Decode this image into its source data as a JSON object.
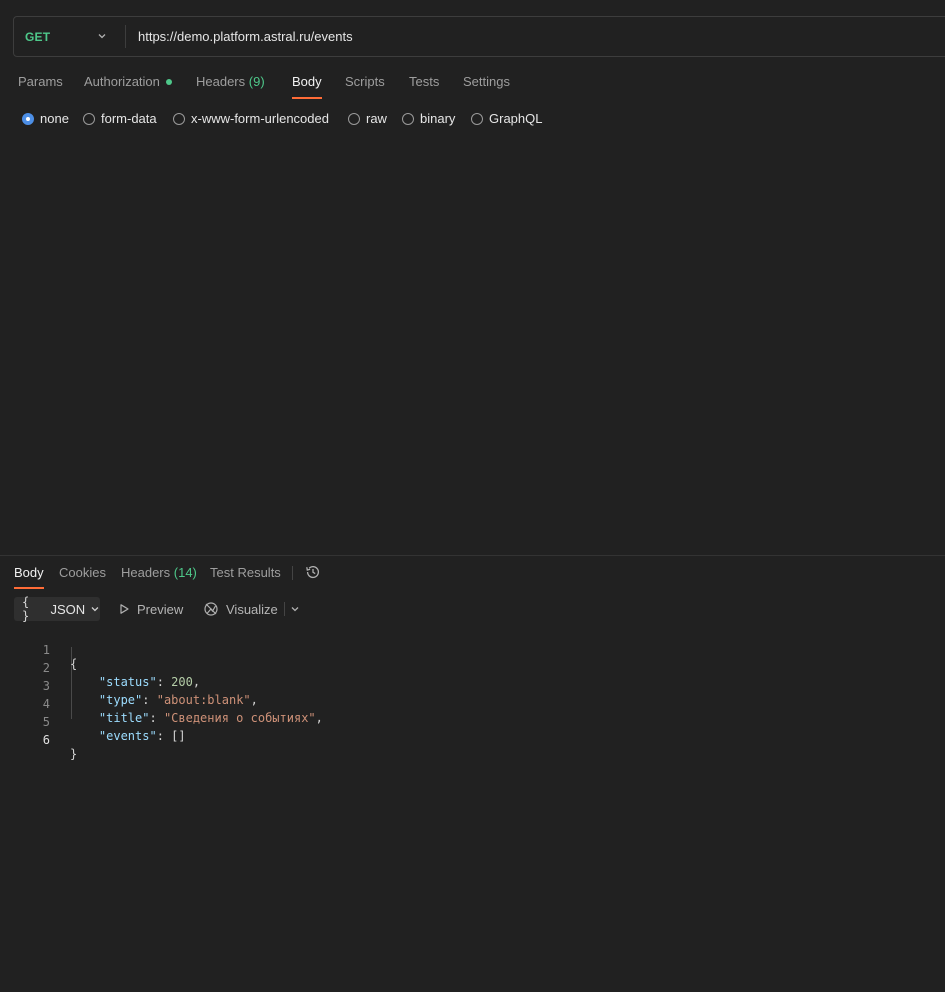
{
  "request": {
    "method": "GET",
    "url": "https://demo.platform.astral.ru/events"
  },
  "request_tabs": [
    {
      "label": "Params"
    },
    {
      "label": "Authorization"
    },
    {
      "label": "Headers",
      "count": "(9)"
    },
    {
      "label": "Body"
    },
    {
      "label": "Scripts"
    },
    {
      "label": "Tests"
    },
    {
      "label": "Settings"
    }
  ],
  "body_types": [
    {
      "label": "none",
      "checked": true
    },
    {
      "label": "form-data"
    },
    {
      "label": "x-www-form-urlencoded"
    },
    {
      "label": "raw"
    },
    {
      "label": "binary"
    },
    {
      "label": "GraphQL"
    }
  ],
  "response_tabs": [
    {
      "label": "Body"
    },
    {
      "label": "Cookies"
    },
    {
      "label": "Headers",
      "count": "(14)"
    },
    {
      "label": "Test Results"
    }
  ],
  "response_toolbar": {
    "format": "JSON",
    "format_braces": "{ }",
    "preview": "Preview",
    "visualize": "Visualize"
  },
  "response_body": {
    "line_numbers": [
      "1",
      "2",
      "3",
      "4",
      "5",
      "6"
    ],
    "open_brace": "{",
    "close_brace": "}",
    "status_key": "\"status\"",
    "status_value": "200",
    "type_key": "\"type\"",
    "type_value": "\"about:blank\"",
    "title_key": "\"title\"",
    "title_value": "\"Сведения о событиях\"",
    "events_key": "\"events\"",
    "events_value": "[]"
  },
  "colors": {
    "accent": "#ff6c37",
    "method_get": "#4ec88a",
    "radio_checked": "#4d8fe6",
    "background": "#212121"
  }
}
